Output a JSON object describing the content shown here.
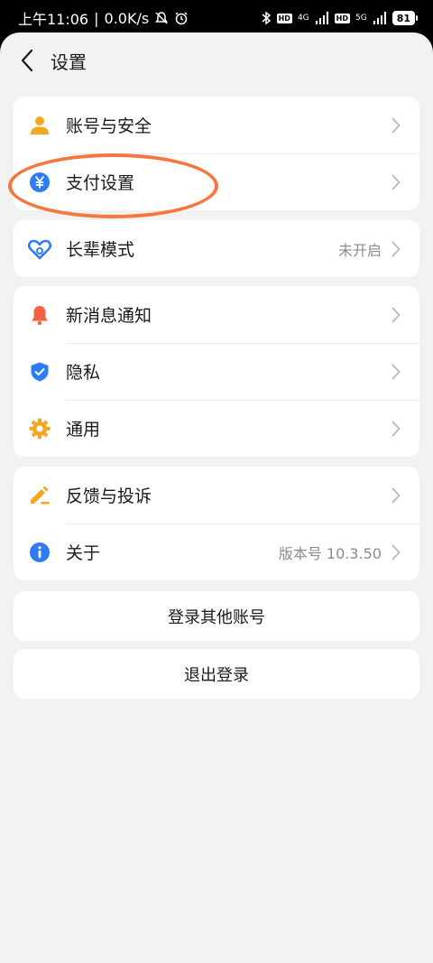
{
  "status_bar": {
    "time": "上午11:06",
    "net_speed": "0.0K/s",
    "network_1": "4G",
    "network_2": "5G",
    "hd_label": "HD",
    "battery": "81"
  },
  "header": {
    "title": "设置"
  },
  "groups": [
    {
      "items": [
        {
          "label": "账号与安全",
          "icon": "person-icon",
          "color": "#f5a623"
        },
        {
          "label": "支付设置",
          "icon": "yuan-icon",
          "color": "#2d7cf6"
        }
      ]
    },
    {
      "items": [
        {
          "label": "长辈模式",
          "value": "未开启",
          "icon": "heart-icon",
          "color": "#2d7cf6"
        }
      ]
    },
    {
      "items": [
        {
          "label": "新消息通知",
          "icon": "bell-icon",
          "color": "#f5613e"
        },
        {
          "label": "隐私",
          "icon": "shield-icon",
          "color": "#2d7cf6"
        },
        {
          "label": "通用",
          "icon": "gear-icon",
          "color": "#f5a623"
        }
      ]
    },
    {
      "items": [
        {
          "label": "反馈与投诉",
          "icon": "pencil-icon",
          "color": "#f5a623"
        },
        {
          "label": "关于",
          "value": "版本号 10.3.50",
          "icon": "info-icon",
          "color": "#2d7cf6"
        }
      ]
    }
  ],
  "buttons": {
    "switch_account": "登录其他账号",
    "logout": "退出登录"
  },
  "annotation": {
    "highlight_color": "#f5763e"
  }
}
